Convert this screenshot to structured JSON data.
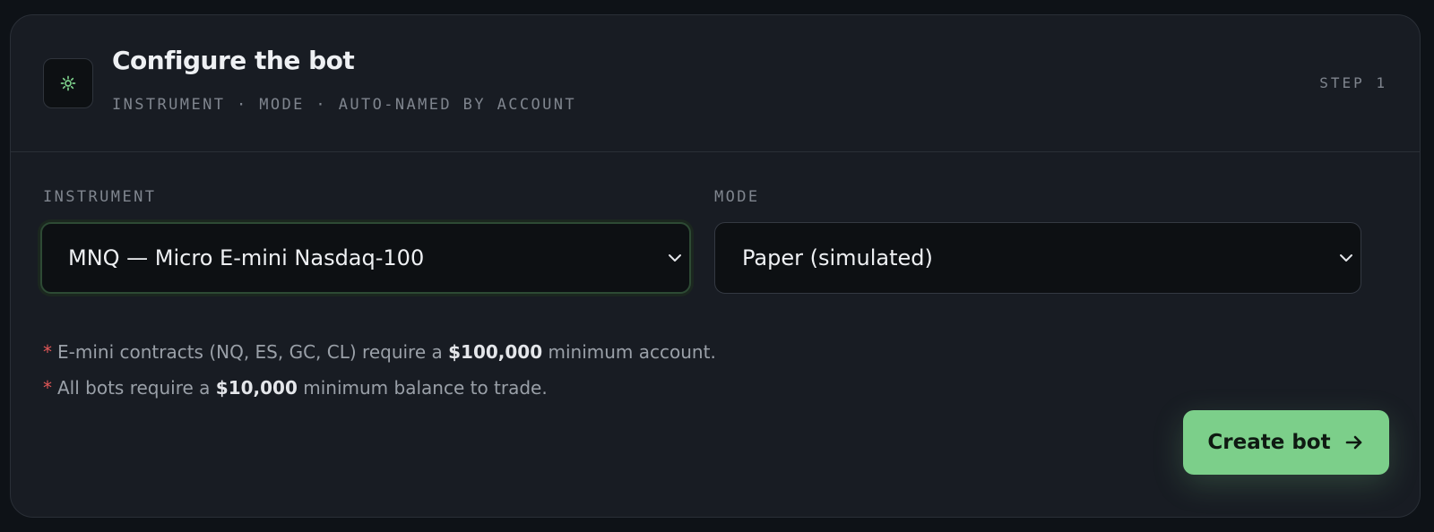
{
  "colors": {
    "background": "#0e1217",
    "card": "#181c23",
    "accent": "#7ccf8a",
    "required_star": "#e05757"
  },
  "header": {
    "icon": "gear-icon",
    "title": "Configure the bot",
    "subtitle": "INSTRUMENT · MODE · AUTO-NAMED BY ACCOUNT",
    "step": "STEP 1"
  },
  "fields": {
    "instrument": {
      "label": "INSTRUMENT",
      "value": "MNQ — Micro E-mini Nasdaq-100",
      "icon": "chevron-down-icon"
    },
    "mode": {
      "label": "MODE",
      "value": "Paper (simulated)",
      "icon": "chevron-down-icon"
    }
  },
  "notes": [
    {
      "star": "*",
      "before": "E-mini contracts (NQ, ES, GC, CL) require a",
      "bold": "$100,000",
      "after": "minimum account."
    },
    {
      "star": "*",
      "before": "All bots require a",
      "bold": "$10,000",
      "after": "minimum balance to trade."
    }
  ],
  "actions": {
    "create_label": "Create bot",
    "create_icon": "arrow-right-icon"
  }
}
